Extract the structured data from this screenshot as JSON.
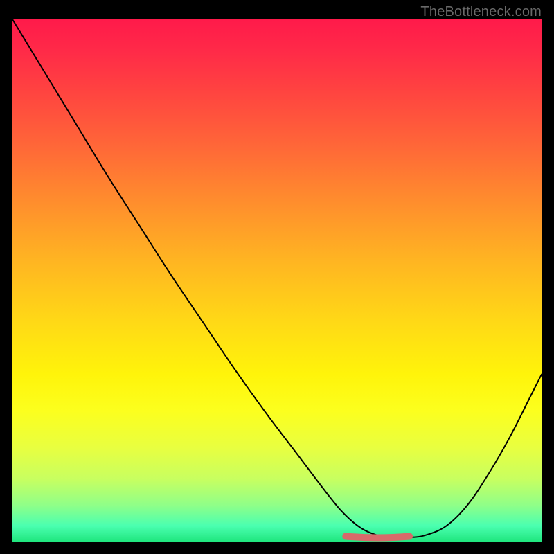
{
  "watermark": "TheBottleneck.com",
  "chart_data": {
    "type": "line",
    "title": "",
    "xlabel": "",
    "ylabel": "",
    "xlim": [
      0,
      100
    ],
    "ylim": [
      0,
      100
    ],
    "series": [
      {
        "name": "bottleneck-curve",
        "x": [
          0,
          6,
          12,
          18,
          24,
          30,
          36,
          42,
          48,
          54,
          60,
          63,
          66,
          69,
          72,
          75,
          78,
          82,
          86,
          90,
          94,
          98,
          100
        ],
        "y": [
          100,
          90,
          80,
          70,
          60.5,
          51,
          42,
          33,
          24.5,
          16.5,
          8.5,
          5,
          2.5,
          1.2,
          0.8,
          0.8,
          1.2,
          3,
          7,
          13,
          20,
          28,
          32
        ]
      },
      {
        "name": "optimal-range-marker",
        "x": [
          63,
          75
        ],
        "y": [
          1.0,
          1.0
        ]
      }
    ],
    "gradient_stops": [
      {
        "pos": 0,
        "color": "#ff1a4a"
      },
      {
        "pos": 6,
        "color": "#ff2a48"
      },
      {
        "pos": 14,
        "color": "#ff4440"
      },
      {
        "pos": 24,
        "color": "#ff6638"
      },
      {
        "pos": 34,
        "color": "#ff8a2e"
      },
      {
        "pos": 46,
        "color": "#ffb422"
      },
      {
        "pos": 58,
        "color": "#ffd916"
      },
      {
        "pos": 68,
        "color": "#fff40a"
      },
      {
        "pos": 75,
        "color": "#fcff1e"
      },
      {
        "pos": 82,
        "color": "#e8ff40"
      },
      {
        "pos": 88,
        "color": "#c8ff60"
      },
      {
        "pos": 93,
        "color": "#90ff88"
      },
      {
        "pos": 97,
        "color": "#4affb0"
      },
      {
        "pos": 100,
        "color": "#20e67e"
      }
    ],
    "marker_color": "#d86a6a"
  }
}
